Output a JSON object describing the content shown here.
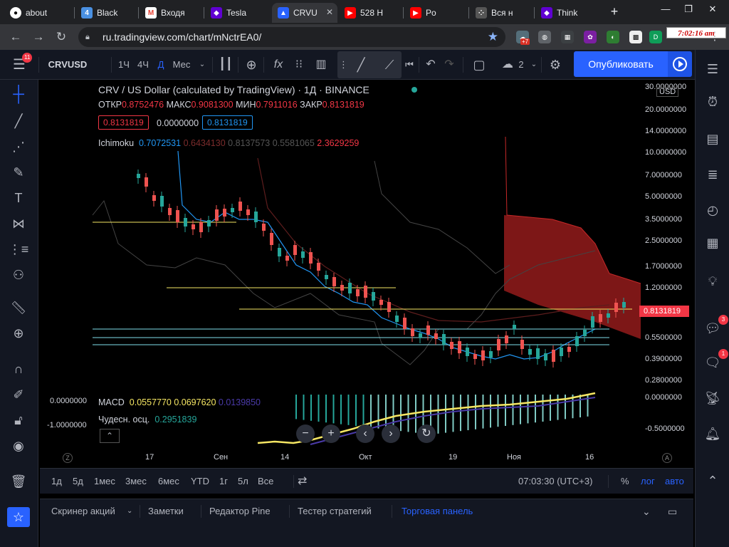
{
  "browser": {
    "tabs": [
      {
        "label": "about",
        "favicon": "github-icon",
        "color": "#24292e"
      },
      {
        "label": "Black",
        "favicon": "book-icon",
        "color": "#4a90e2"
      },
      {
        "label": "Входя",
        "favicon": "gmail-icon",
        "color": "#ea4335"
      },
      {
        "label": "Tesla",
        "favicon": "yahoo-icon",
        "color": "#6001d2"
      },
      {
        "label": "CRVU",
        "favicon": "tradingview-icon",
        "color": "#2962ff",
        "active": true
      },
      {
        "label": "528 H",
        "favicon": "youtube-icon",
        "color": "#ff0000"
      },
      {
        "label": "Po",
        "favicon": "youtube-icon",
        "color": "#ff0000"
      },
      {
        "label": "Вся н",
        "favicon": "dots-icon",
        "color": "#888888"
      },
      {
        "label": "Think",
        "favicon": "yahoo-icon",
        "color": "#6001d2"
      }
    ],
    "new_tab": "+",
    "url": "ru.tradingview.com/chart/mNctrEA0/",
    "clock": "7:02:16 am",
    "weather_badge": "+7"
  },
  "toolbar": {
    "notifications": "11",
    "symbol": "CRVUSD",
    "intervals": [
      "1Ч",
      "4Ч",
      "Д",
      "Мес"
    ],
    "active_interval": "Д",
    "layout_count": "2",
    "publish_label": "Опубликовать"
  },
  "chart": {
    "title": "CRV / US Dollar (calculated by TradingView) · 1Д · BINANCE",
    "ohlc": {
      "open_label": "ОТКР",
      "open": "0.8752476",
      "high_label": "МАКС",
      "high": "0.9081300",
      "low_label": "МИН",
      "low": "0.7911016",
      "close_label": "ЗАКР",
      "close": "0.8131819"
    },
    "price_boxes": [
      "0.8131819",
      "0.0000000",
      "0.8131819"
    ],
    "ichimoku": {
      "label": "Ichimoku",
      "v1": "0.7072531",
      "v2": "0.6434130",
      "v3": "0.8137573",
      "v4": "0.5581065",
      "v5": "2.3629259"
    },
    "macd": {
      "label": "MACD",
      "v1": "0.0557770",
      "v2": "0.0697620",
      "v3": "0.0139850"
    },
    "ao": {
      "label": "Чудесн. осц.",
      "v1": "0.2951839"
    },
    "currency": "USD",
    "current_price": "0.8131819",
    "price_axis": [
      "30.0000000",
      "20.0000000",
      "14.0000000",
      "10.0000000",
      "7.0000000",
      "5.0000000",
      "3.5000000",
      "2.5000000",
      "1.7000000",
      "1.2000000",
      "0.5500000",
      "0.3900000",
      "0.2800000",
      "0.0000000",
      "-0.5000000"
    ],
    "indicator_axis_left": [
      "0.0000000",
      "-1.0000000"
    ],
    "time_axis": [
      "17",
      "Сен",
      "14",
      "Окт",
      "19",
      "Ноя",
      "16"
    ],
    "corner_labels": [
      "Z",
      "A"
    ]
  },
  "chart_data": {
    "type": "candlestick",
    "title": "CRV / US Dollar (calculated by TradingView) · 1Д · BINANCE",
    "yscale": "log",
    "ylim": [
      0.25,
      30
    ],
    "x_ticks": [
      "17",
      "Сен",
      "14",
      "Окт",
      "19",
      "Ноя",
      "16"
    ],
    "last_close": 0.8131819
  },
  "timebar": {
    "ranges": [
      "1д",
      "5д",
      "1мес",
      "3мес",
      "6мес",
      "YTD",
      "1г",
      "5л",
      "Все"
    ],
    "time": "07:03:30 (UTC+3)",
    "percent": "%",
    "log": "лог",
    "auto": "авто"
  },
  "panels": {
    "items": [
      "Скринер акций",
      "Заметки",
      "Редактор Pine",
      "Тестер стратегий",
      "Торговая панель"
    ],
    "active": "Торговая панель"
  },
  "right_badges": [
    "3",
    "1"
  ]
}
